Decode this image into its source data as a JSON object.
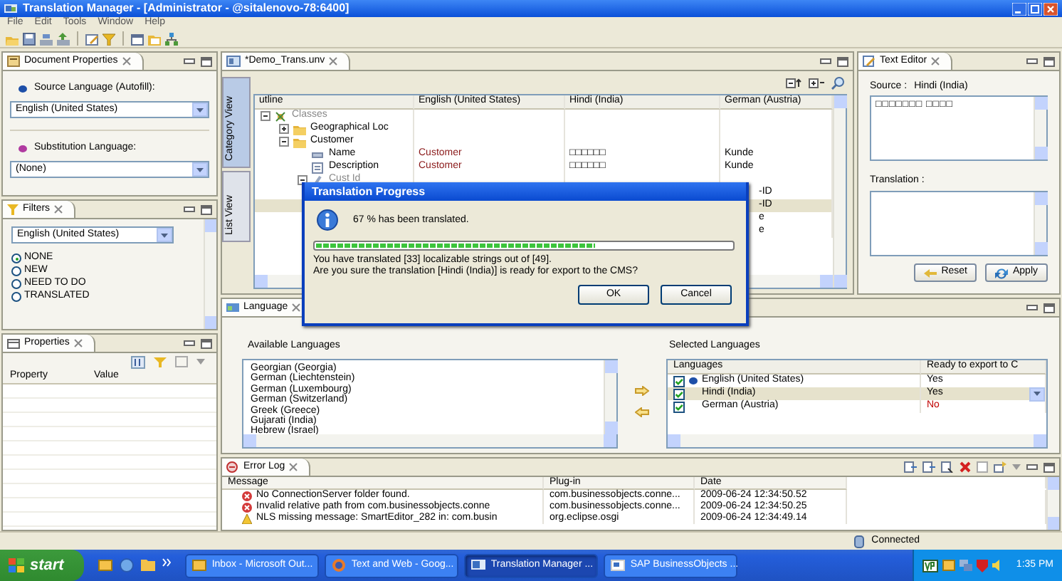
{
  "window": {
    "title": "Translation Manager - [Administrator - @sitalenovo-78:6400]"
  },
  "menu": [
    "File",
    "Edit",
    "Tools",
    "Window",
    "Help"
  ],
  "document_properties": {
    "title": "Document Properties",
    "source_label": "Source Language (Autofill):",
    "source_value": "English (United States)",
    "substitution_label": "Substitution Language:",
    "substitution_value": "(None)"
  },
  "filters": {
    "title": "Filters",
    "language": "English (United States)",
    "options": [
      {
        "label": "NONE",
        "selected": true
      },
      {
        "label": "NEW",
        "selected": false
      },
      {
        "label": "NEED TO DO",
        "selected": false
      },
      {
        "label": "TRANSLATED",
        "selected": false
      }
    ]
  },
  "properties": {
    "title": "Properties",
    "columns": [
      "Property",
      "Value"
    ]
  },
  "editor": {
    "title": "*Demo_Trans.unv",
    "side_tabs": [
      {
        "label": "Category View",
        "selected": true
      },
      {
        "label": "List View",
        "selected": false
      }
    ],
    "columns": [
      "utline",
      "English (United States)",
      "Hindi (India)",
      "German (Austria)"
    ],
    "tree": [
      {
        "label": "Classes",
        "kind": "classes",
        "expanded": true,
        "children": [
          {
            "label": "Geographical Loc",
            "kind": "folder",
            "expanded": false
          },
          {
            "label": "Customer",
            "kind": "folder",
            "expanded": true,
            "children": [
              {
                "label": "Name",
                "kind": "name",
                "english": "Customer",
                "hindi": "□□□□□□",
                "german": "Kunde"
              },
              {
                "label": "Description",
                "kind": "description",
                "english": "Customer",
                "hindi": "□□□□□□",
                "german": "Kunde"
              },
              {
                "label": "Cust Id",
                "kind": "object",
                "expanded": true
              }
            ]
          }
        ]
      }
    ],
    "partial_rows": [
      {
        "german": "-ID",
        "selected": false
      },
      {
        "german": "-ID",
        "selected": true
      },
      {
        "german": "e",
        "selected": false
      },
      {
        "german": "e",
        "selected": false
      }
    ]
  },
  "text_editor": {
    "title": "Text Editor",
    "source_label": "Source :",
    "source_language": "Hindi (India)",
    "source_text": "□□□□□□□ □□□□",
    "translation_label": "Translation :",
    "buttons": [
      "Reset",
      "Apply"
    ]
  },
  "dialog": {
    "title": "Translation Progress",
    "message": "67 % has been translated.",
    "level": 0.67,
    "details": [
      "You have translated [33] localizable strings out of [49].",
      "Are you sure the translation [Hindi (India)] is ready for export to the CMS?"
    ],
    "buttons": [
      "OK",
      "Cancel"
    ]
  },
  "language": {
    "title": "Language",
    "available_title": "Available Languages",
    "available": [
      "Georgian (Georgia)",
      "German (Liechtenstein)",
      "German (Luxembourg)",
      "German (Switzerland)",
      "Greek (Greece)",
      "Gujarati (India)",
      "Hebrew (Israel)"
    ],
    "selected_title": "Selected Languages",
    "columns": [
      "Languages",
      "Ready to export to C"
    ],
    "rows": [
      {
        "name": "English (United States)",
        "checked": true,
        "source": true,
        "ready": "Yes",
        "exportable": true,
        "selected": false
      },
      {
        "name": "Hindi (India)",
        "checked": true,
        "source": false,
        "ready": "Yes",
        "exportable": true,
        "selected": true
      },
      {
        "name": "German (Austria)",
        "checked": true,
        "source": false,
        "ready": "No",
        "exportable": false,
        "selected": false
      }
    ]
  },
  "error_log": {
    "title": "Error Log",
    "columns": [
      "Message",
      "Plug-in",
      "Date"
    ],
    "rows": [
      {
        "kind": "error",
        "message": "No ConnectionServer folder found.",
        "plugin": "com.businessobjects.conne...",
        "date": "2009-06-24 12:34:50.52"
      },
      {
        "kind": "error",
        "message": "Invalid relative path from com.businessobjects.conne",
        "plugin": "com.businessobjects.conne...",
        "date": "2009-06-24 12:34:50.25"
      },
      {
        "kind": "warning",
        "message": "NLS missing message: SmartEditor_282 in: com.busin",
        "plugin": "org.eclipse.osgi",
        "date": "2009-06-24 12:34:49.14"
      }
    ]
  },
  "status_bar": {
    "text": "Connected"
  },
  "taskbar": {
    "start": "start",
    "tasks": [
      {
        "label": "Inbox - Microsoft Out...",
        "selected": false
      },
      {
        "label": "Text and Web - Goog...",
        "selected": false
      },
      {
        "label": "Translation Manager ...",
        "selected": true
      },
      {
        "label": "SAP BusinessObjects ...",
        "selected": false
      }
    ],
    "time": "1:35 PM"
  }
}
